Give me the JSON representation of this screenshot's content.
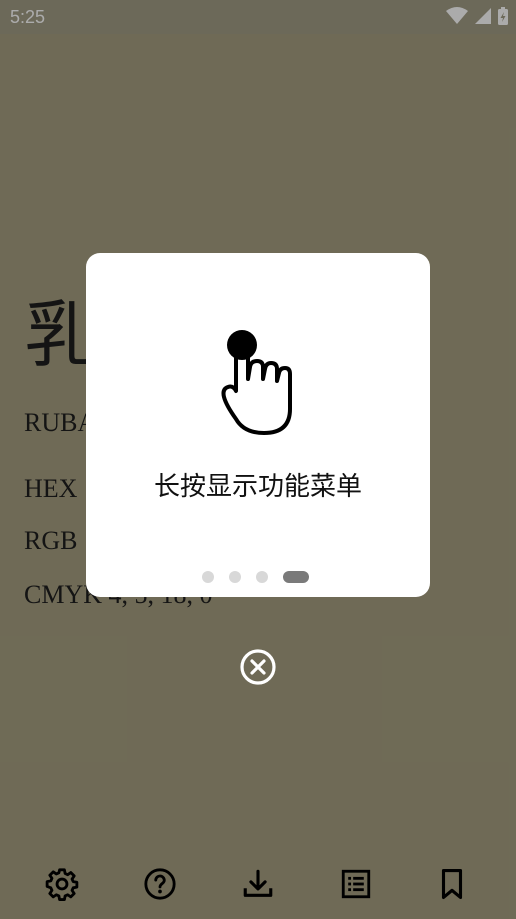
{
  "status_bar": {
    "time": "5:25",
    "icons": [
      "wifi-icon",
      "signal-icon",
      "battery-charging-icon"
    ]
  },
  "color_detail": {
    "character": "乳",
    "name_line": "RUBA",
    "hex_line": "HEX",
    "rgb_line": "RGB",
    "cmyk_line": "CMYK 4, 5, 18, 0",
    "background_color": "#a69f80"
  },
  "tutorial_dialog": {
    "icon": "tap-hand-icon",
    "message": "长按显示功能菜单",
    "pages": 4,
    "current_page": 4
  },
  "close_button": {
    "icon": "close-circle-icon"
  },
  "bottom_nav": [
    {
      "icon": "settings-icon"
    },
    {
      "icon": "help-icon"
    },
    {
      "icon": "download-icon"
    },
    {
      "icon": "list-icon"
    },
    {
      "icon": "bookmark-icon"
    }
  ]
}
